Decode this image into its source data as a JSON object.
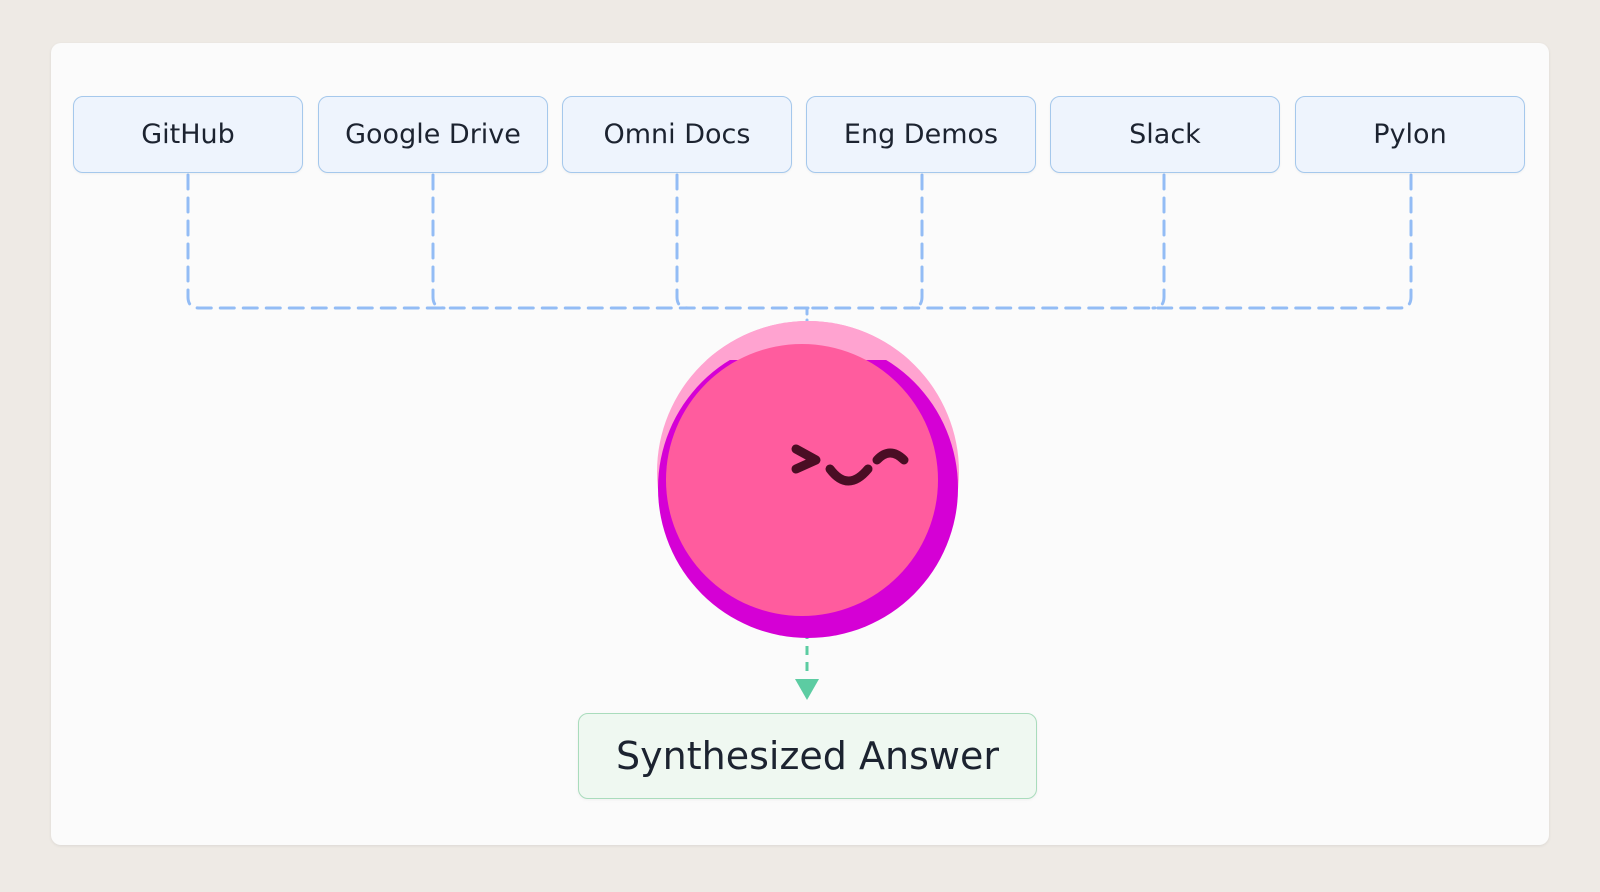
{
  "sources": [
    {
      "label": "GitHub"
    },
    {
      "label": "Google Drive"
    },
    {
      "label": "Omni Docs"
    },
    {
      "label": "Eng Demos"
    },
    {
      "label": "Slack"
    },
    {
      "label": "Pylon"
    }
  ],
  "output": {
    "label": "Synthesized Answer"
  },
  "colors": {
    "source_fill": "#eef4fd",
    "source_border": "#a5c8ec",
    "connector_blue": "#93bcf5",
    "connector_green": "#5ccca2",
    "answer_fill": "#eff8f1",
    "answer_border": "#a9dcbc",
    "mascot_main": "#ff5c9e",
    "mascot_highlight": "#ffa3d0",
    "mascot_shadow": "#d500d5",
    "mascot_face": "#4a0d24"
  },
  "mascot": {
    "icon": "winking-pink-blob-mascot"
  }
}
